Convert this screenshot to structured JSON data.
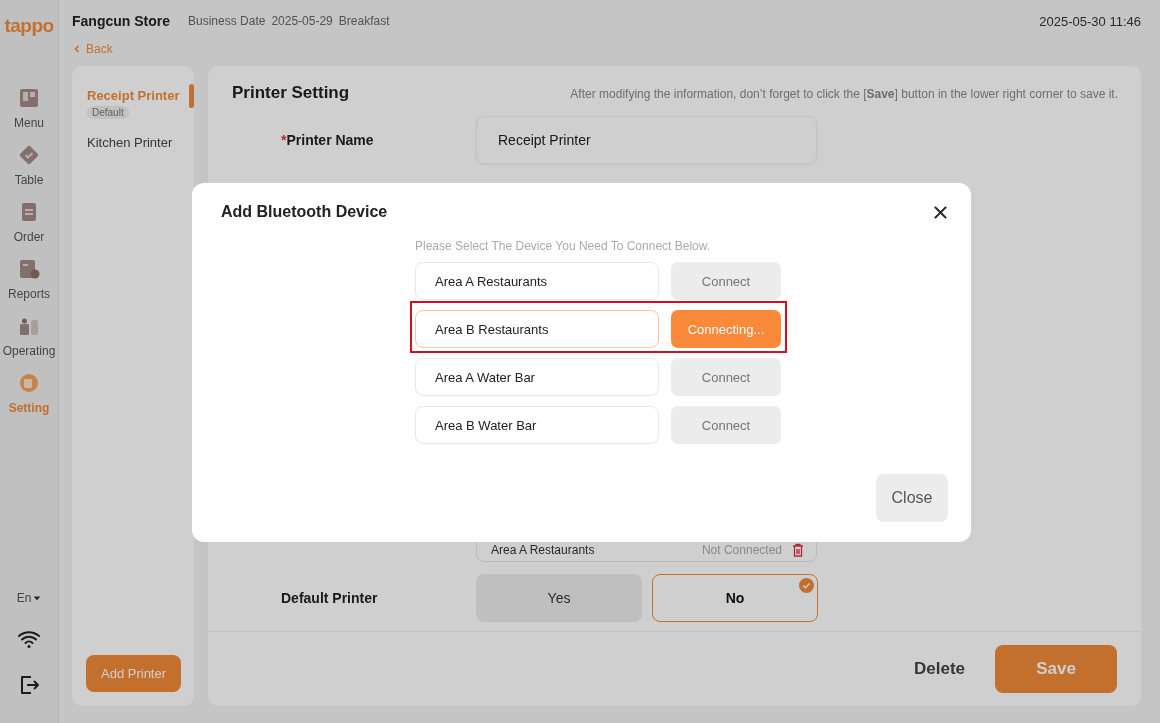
{
  "brand": {
    "logo": "tappo"
  },
  "header": {
    "store": "Fangcun Store",
    "business_date_label": "Business Date",
    "business_date": "2025-05-29",
    "meal": "Breakfast",
    "datetime": "2025-05-30 11:46"
  },
  "back": "Back",
  "nav": [
    {
      "label": "Menu",
      "kind": "menu",
      "selected": false
    },
    {
      "label": "Table",
      "kind": "table",
      "selected": false
    },
    {
      "label": "Order",
      "kind": "order",
      "selected": false
    },
    {
      "label": "Reports",
      "kind": "reports",
      "selected": false
    },
    {
      "label": "Operating",
      "kind": "operating",
      "selected": false
    },
    {
      "label": "Setting",
      "kind": "setting",
      "selected": true
    }
  ],
  "language": "En",
  "printers": [
    {
      "name": "Receipt Printer",
      "badge": "Default",
      "selected": true
    },
    {
      "name": "Kitchen Printer",
      "selected": false
    }
  ],
  "add_printer": "Add Printer",
  "settings": {
    "title": "Printer Setting",
    "hint": "After modifying the information, don’t forget to click the [**Save**] button in the lower right corner to save it.",
    "required_mark": "*",
    "name_label": "Printer Name",
    "name_value": "Receipt Printer",
    "device": {
      "name": "Area A Restaurants",
      "status": "Not Connected"
    },
    "default_label": "Default Printer",
    "default_options": [
      {
        "label": "Yes",
        "selected": false
      },
      {
        "label": "No",
        "selected": true
      }
    ]
  },
  "footer": {
    "delete": "Delete",
    "save": "Save"
  },
  "dialog": {
    "title": "Add Bluetooth Device",
    "instruction": "Please Select The Device You Need To Connect Below.",
    "close": "Close",
    "devices": [
      {
        "name": "Area A Restaurants",
        "action": "Connect",
        "connecting": false,
        "highlighted": false
      },
      {
        "name": "Area B Restaurants",
        "action": "Connecting...",
        "connecting": true,
        "highlighted": true
      },
      {
        "name": "Area A Water Bar",
        "action": "Connect",
        "connecting": false,
        "highlighted": false
      },
      {
        "name": "Area B Water Bar",
        "action": "Connect",
        "connecting": false,
        "highlighted": false
      }
    ]
  }
}
